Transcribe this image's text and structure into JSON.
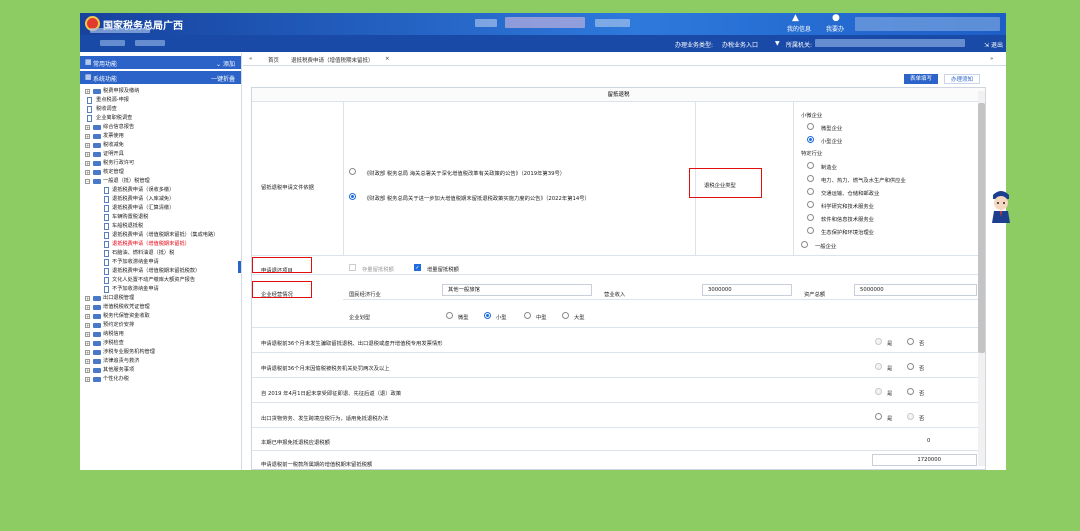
{
  "header": {
    "title": "国家税务总局广西",
    "icons": [
      "我的信息",
      "我要办"
    ]
  },
  "subheader": {
    "business_type_label": "办理业务类型:",
    "business_type_value": "办税业务入口",
    "tax_authority_label": "所属机关:",
    "exit": "退出"
  },
  "sidebar": {
    "common_label": "常用功能",
    "add_label": "添加",
    "system_label": "系统功能",
    "expand_label": "一键折叠",
    "items": [
      {
        "label": "税费申报及缴纳",
        "level": 0,
        "type": "folder"
      },
      {
        "label": "重点税源-申报",
        "level": 0,
        "type": "page"
      },
      {
        "label": "税收调查",
        "level": 0,
        "type": "page"
      },
      {
        "label": "企业离职税调查",
        "level": 0,
        "type": "page"
      },
      {
        "label": "综合信息报告",
        "level": 0,
        "type": "folder"
      },
      {
        "label": "发票使用",
        "level": 0,
        "type": "folder"
      },
      {
        "label": "税收减免",
        "level": 0,
        "type": "folder"
      },
      {
        "label": "证明开具",
        "level": 0,
        "type": "folder"
      },
      {
        "label": "税务行政许可",
        "level": 0,
        "type": "folder"
      },
      {
        "label": "核定管理",
        "level": 0,
        "type": "folder"
      },
      {
        "label": "一般退（抵）税管理",
        "level": 0,
        "type": "folder"
      },
      {
        "label": "退抵税费申请（误收多缴）",
        "level": 1
      },
      {
        "label": "退抵税费申请（入库减免）",
        "level": 1
      },
      {
        "label": "退抵税费申请（汇算清缴）",
        "level": 1
      },
      {
        "label": "车辆购置税退税",
        "level": 1
      },
      {
        "label": "车船税退抵税",
        "level": 1
      },
      {
        "label": "退抵税费申请（增值税期末留抵）（集成电路）",
        "level": 1
      },
      {
        "label": "退抵税费申请（增值税期末留抵）",
        "level": 1,
        "active": true
      },
      {
        "label": "石脑油、燃料油退（抵）税",
        "level": 1
      },
      {
        "label": "不予加收滞纳金申请",
        "level": 1
      },
      {
        "label": "退抵税费申请（增值税期末留抵税款）",
        "level": 1
      },
      {
        "label": "文化人处置不动产缴库大额资产报告",
        "level": 1
      },
      {
        "label": "不予加收滞纳金申请",
        "level": 1
      },
      {
        "label": "出口退税管理",
        "level": 0,
        "type": "folder"
      },
      {
        "label": "增值税税收凭证管理",
        "level": 0,
        "type": "folder"
      },
      {
        "label": "税务代保管资金收取",
        "level": 0,
        "type": "folder"
      },
      {
        "label": "预约定价安排",
        "level": 0,
        "type": "folder"
      },
      {
        "label": "纳税信用",
        "level": 0,
        "type": "folder"
      },
      {
        "label": "涉税检查",
        "level": 0,
        "type": "folder"
      },
      {
        "label": "涉税专业服务机构管理",
        "level": 0,
        "type": "folder"
      },
      {
        "label": "法律追责与救济",
        "level": 0,
        "type": "folder"
      },
      {
        "label": "其他服务事项",
        "level": 0,
        "type": "folder"
      },
      {
        "label": "个性化办税",
        "level": 0,
        "type": "folder"
      }
    ]
  },
  "tabs": {
    "home": "首页",
    "current": "退抵税费申请（增值税期末留抵）",
    "close": "×",
    "nav_left": "«",
    "nav_right": "»"
  },
  "subtabs": {
    "form": "表单填写",
    "guide": "办理须知"
  },
  "form": {
    "section": "留抵退税",
    "basis_label": "留抵退税申请文件依据",
    "basis_opt1": "《财政部 税务总局 海关总署关于深化增值税改革有关政策的公告》（2019年第39号）",
    "basis_opt2": "《财政部 税务总局关于进一步加大增值税期末留抵退税政策实施力度的公告》（2022年第14号）",
    "enterprise_type_label": "退税企业类型",
    "micro_label": "小微企业",
    "tiny": "微型企业",
    "small": "小型企业",
    "industry_label": "特定行业",
    "ind1": "制造业",
    "ind2": "电力、热力、燃气及水生产和供应业",
    "ind3": "交通运输、仓储和邮政业",
    "ind4": "科学研究和技术服务业",
    "ind5": "软件和信息技术服务业",
    "ind6": "生态保护和环境治理业",
    "general": "一般企业",
    "refund_item_label": "申请退还项目",
    "stock_refund": "存量留抵税额",
    "incr_refund": "增量留抵税额",
    "biz_label": "企业经营情况",
    "industry_field_label": "国民经济行业",
    "industry_field_value": "其他一般旅馆",
    "revenue_label": "营业收入",
    "revenue_value": "3000000",
    "assets_label": "资产总额",
    "assets_value": "5000000",
    "scale_label": "企业划型",
    "scale_opts": [
      "微型",
      "小型",
      "中型",
      "大型"
    ],
    "q1": "申请退税前36个月未发生骗取留抵退税、出口退税或虚开增值税专用发票情形",
    "q2": "申请退税前36个月未因偷税被税务机关处罚两次及以上",
    "q3": "自 2019 年4月1日起未享受即征即退、先征后返（退）政策",
    "q4": "出口货物劳务、发生跨境应税行为，适用免抵退税办法",
    "yes": "是",
    "no": "否",
    "row5": "本期已申报免抵退税应退税额",
    "row5_value": "0",
    "row6": "申请退税前一税款所属期的增值税期末留抵税额",
    "row6_value": "1720000"
  }
}
